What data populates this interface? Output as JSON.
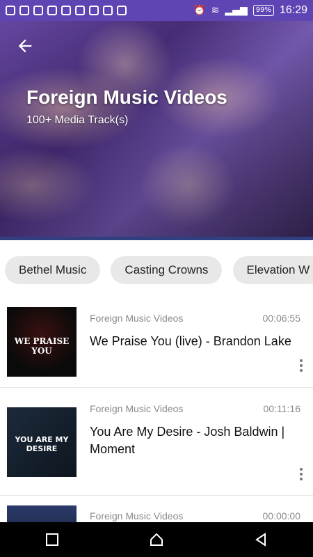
{
  "status_bar": {
    "time": "16:29",
    "battery": "99%"
  },
  "header": {
    "title": "Foreign Music Videos",
    "subtitle": "100+ Media Track(s)"
  },
  "chips": [
    {
      "label": "Bethel Music"
    },
    {
      "label": "Casting Crowns"
    },
    {
      "label": "Elevation W"
    }
  ],
  "tracks": [
    {
      "source": "Foreign Music Videos",
      "duration": "00:06:55",
      "title": "We Praise You (live) - Brandon Lake",
      "thumb_text": "WE PRAISE YOU"
    },
    {
      "source": "Foreign Music Videos",
      "duration": "00:11:16",
      "title": "You Are My Desire - Josh Baldwin | Moment",
      "thumb_text": "YOU ARE MY DESIRE"
    },
    {
      "source": "Foreign Music Videos",
      "duration": "00:00:00",
      "title": "",
      "thumb_text": ""
    }
  ],
  "colors": {
    "status_bar": "#5e45b3",
    "chip_bg": "#e8e8e8",
    "hero_line": "#2f3f7f"
  }
}
